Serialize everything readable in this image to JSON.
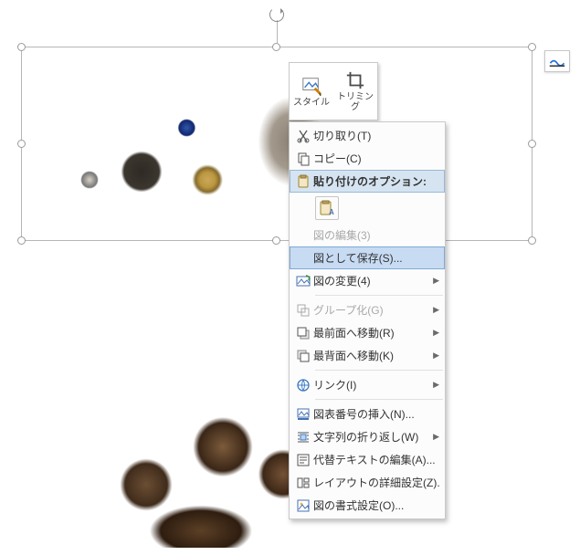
{
  "mini_toolbar": {
    "style_label": "スタイル",
    "trimming_label": "トリミング"
  },
  "context_menu": {
    "cut": "切り取り(T)",
    "copy": "コピー(C)",
    "paste_options_header": "貼り付けのオプション:",
    "edit_picture": "図の編集(3)",
    "save_as_picture": "図として保存(S)...",
    "change_picture": "図の変更(4)",
    "group": "グループ化(G)",
    "bring_to_front": "最前面へ移動(R)",
    "send_to_back": "最背面へ移動(K)",
    "link": "リンク(I)",
    "insert_caption": "図表番号の挿入(N)...",
    "text_wrapping": "文字列の折り返し(W)",
    "edit_alt_text": "代替テキストの編集(A)...",
    "layout_details": "レイアウトの詳細設定(Z)...",
    "format_picture": "図の書式設定(O)..."
  }
}
